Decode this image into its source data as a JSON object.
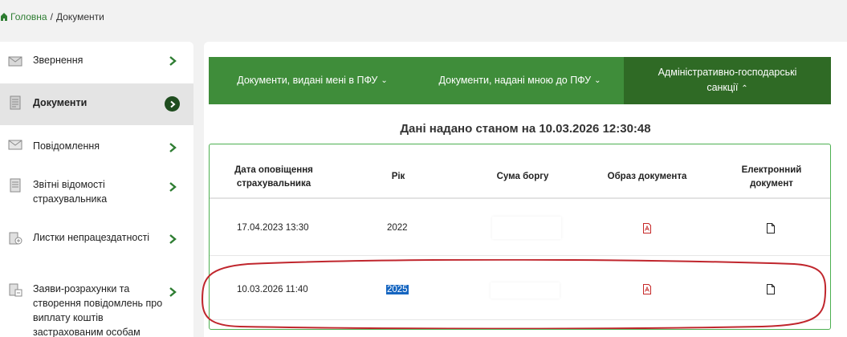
{
  "breadcrumb": {
    "home": "Головна",
    "separator": "/",
    "current": "Документи"
  },
  "sidebar": {
    "items": [
      {
        "label": "Звернення",
        "icon": "envelope-icon"
      },
      {
        "label": "Документи",
        "icon": "document-icon",
        "active": true
      },
      {
        "label": "Повідомлення",
        "icon": "envelope-icon"
      },
      {
        "label": "Звітні відомості страхувальника",
        "icon": "report-icon"
      },
      {
        "label": "Листки непрацездатності",
        "icon": "sick-leave-icon"
      },
      {
        "label": "Заяви-розрахунки та створення повідомлень про виплату коштів застрахованим особам",
        "icon": "application-icon"
      }
    ]
  },
  "tabs": [
    {
      "label": "Документи, видані мені в ПФУ",
      "caret": "⌄"
    },
    {
      "label": "Документи, надані мною до ПФУ",
      "caret": "⌄"
    },
    {
      "label": "Адміністративно-господарські санкції",
      "caret": "⌃",
      "active": true
    }
  ],
  "as_of": "Дані надано станом на 10.03.2026 12:30:48",
  "table": {
    "headers": [
      "Дата оповіщення страхувальника",
      "Рік",
      "Сума боргу",
      "Образ документа",
      "Електронний документ"
    ],
    "rows": [
      {
        "date": "17.04.2023 13:30",
        "year": "2022",
        "sum": ""
      },
      {
        "date": "10.03.2026 11:40",
        "year": "2025",
        "sum": ""
      }
    ]
  },
  "colors": {
    "accent_green": "#3f8d3a",
    "dark_green": "#2f6a25",
    "pdf_red": "#c62828",
    "annotation_red": "#c0262d",
    "selection_blue": "#1565c0"
  }
}
